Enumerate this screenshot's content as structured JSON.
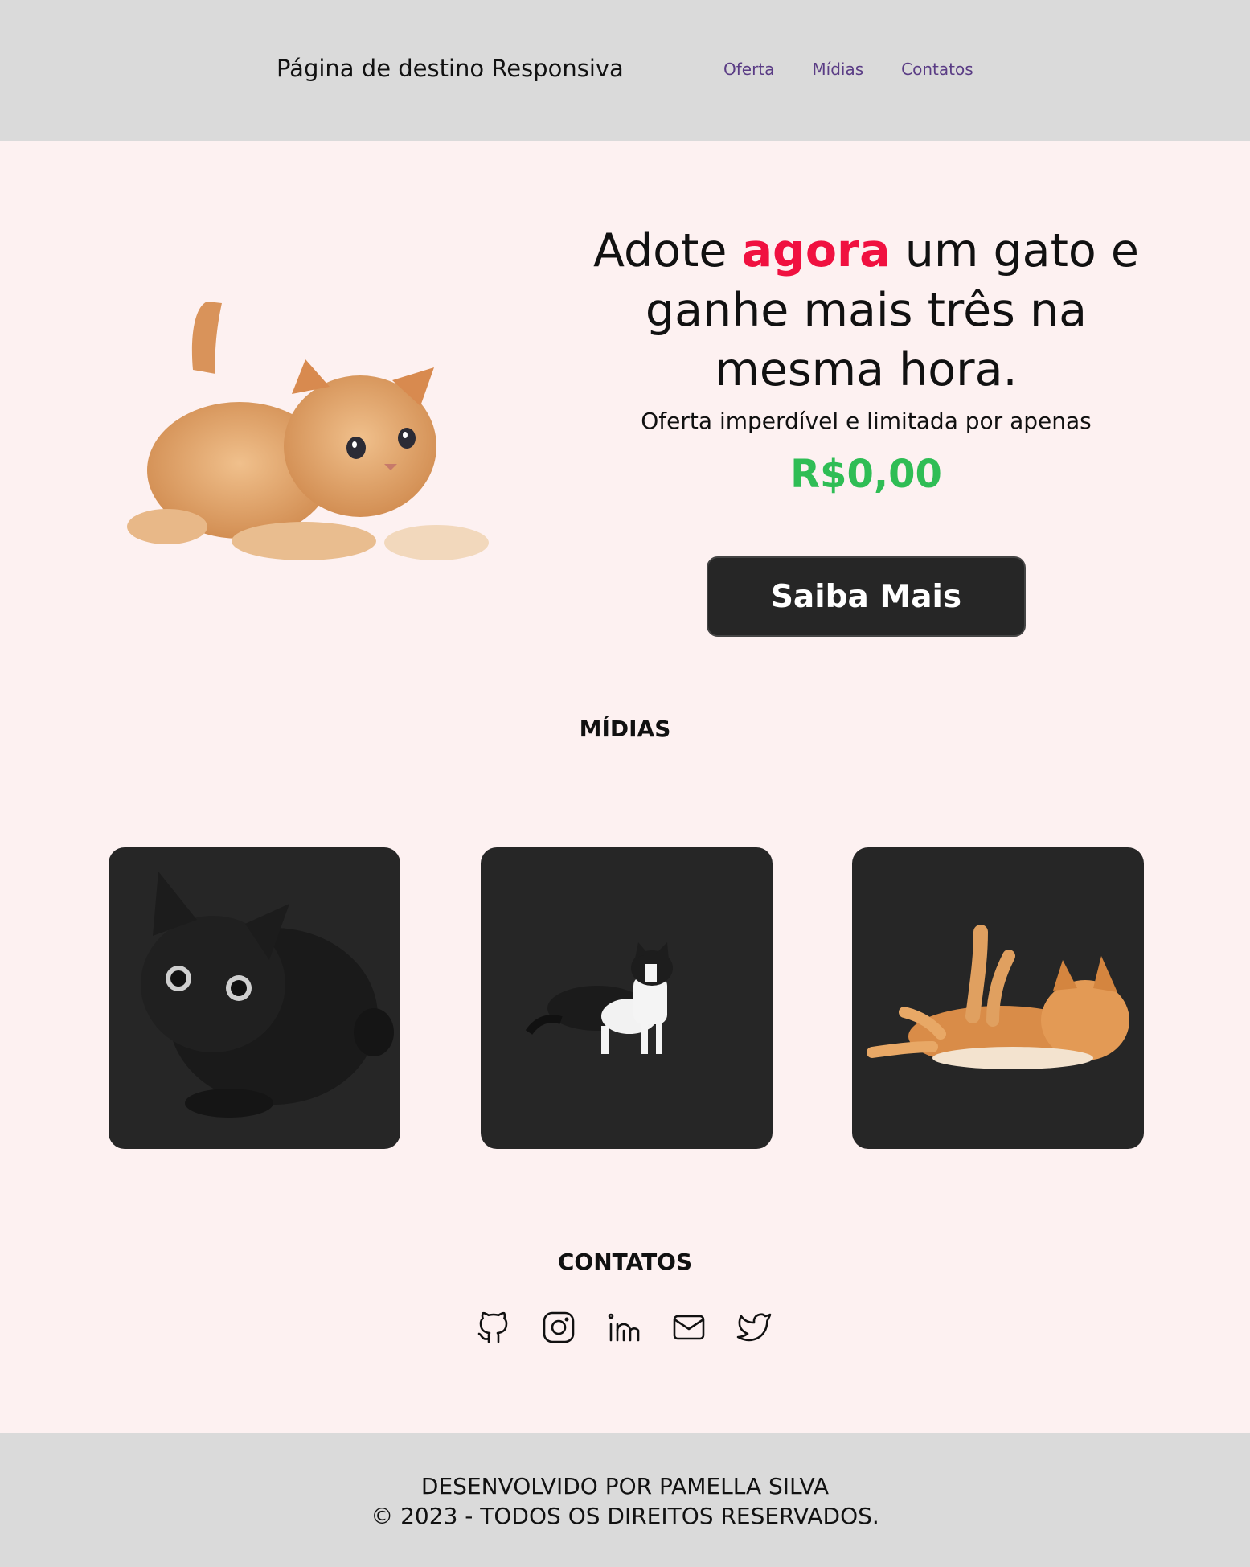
{
  "header": {
    "brand": "Página de destino Responsiva",
    "nav": [
      "Oferta",
      "Mídias",
      "Contatos"
    ]
  },
  "hero": {
    "headline_before": "Adote ",
    "headline_accent": "agora",
    "headline_after": " um gato e ganhe mais três na mesma hora.",
    "subline": "Oferta imperdível e limitada por apenas",
    "price": "R$0,00",
    "cta_label": "Saiba Mais",
    "accent_color": "#f01140",
    "price_color": "#2fbd55"
  },
  "media": {
    "title": "MÍDIAS",
    "cards": [
      "black-cat-photo",
      "tuxedo-cat-photo",
      "orange-cat-photo"
    ]
  },
  "contacts": {
    "title": "CONTATOS",
    "icons": [
      "github-icon",
      "instagram-icon",
      "linkedin-icon",
      "mail-icon",
      "twitter-icon"
    ]
  },
  "footer": {
    "line1": "DESENVOLVIDO POR PAMELLA SILVA",
    "line2": "© 2023 - TODOS OS DIREITOS RESERVADOS."
  }
}
